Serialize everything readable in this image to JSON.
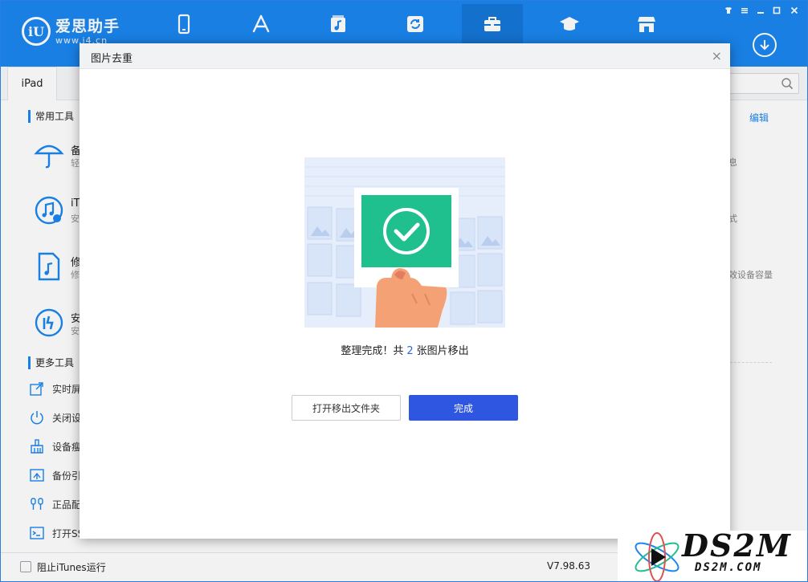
{
  "app": {
    "logo_mark": "iU",
    "title": "爱思助手",
    "url": "www.i4.cn"
  },
  "nav": [
    {
      "name": "my-device",
      "icon": "phone-icon"
    },
    {
      "name": "apps",
      "icon": "app-store-icon"
    },
    {
      "name": "ringtones",
      "icon": "music-icon"
    },
    {
      "name": "flash",
      "icon": "refresh-icon"
    },
    {
      "name": "toolbox",
      "icon": "toolbox-icon",
      "active": true
    },
    {
      "name": "tutorials",
      "icon": "graduation-cap-icon"
    },
    {
      "name": "store",
      "icon": "store-icon"
    }
  ],
  "tab": {
    "label": "iPad"
  },
  "left": {
    "common_title": "常用工具",
    "tools": [
      {
        "title": "备",
        "sub": "轻",
        "icon": "umbrella-icon"
      },
      {
        "title": "iT",
        "sub": "安",
        "icon": "itunes-icon"
      },
      {
        "title": "修",
        "sub": "修",
        "icon": "music-file-icon"
      },
      {
        "title": "安",
        "sub": "安",
        "icon": "i4-icon"
      }
    ],
    "more_title": "更多工具",
    "more": [
      {
        "label": "实时屏",
        "icon": "screen-share-icon"
      },
      {
        "label": "关闭设",
        "icon": "power-icon"
      },
      {
        "label": "设备瘦",
        "icon": "broom-icon"
      },
      {
        "label": "备份引",
        "icon": "backup-icon"
      },
      {
        "label": "正品配",
        "icon": "earphone-icon"
      },
      {
        "label": "打开SS",
        "icon": "terminal-icon"
      }
    ]
  },
  "right": {
    "edit": "编辑",
    "texts": [
      "息",
      "式",
      "效设备容量"
    ]
  },
  "dialog": {
    "title": "图片去重",
    "close": "×",
    "message_prefix": "整理完成！共",
    "count": "2",
    "message_suffix": "张图片移出",
    "open_button": "打开移出文件夹",
    "done_button": "完成"
  },
  "status": {
    "checkbox_label": "阻止iTunes运行",
    "version": "V7.98.63"
  },
  "watermark": {
    "brand": "DS2M",
    "url": "DS2M.COM"
  },
  "colors": {
    "header": "#1b86f0",
    "accent": "#2f56e0",
    "success": "#1fc08e"
  }
}
